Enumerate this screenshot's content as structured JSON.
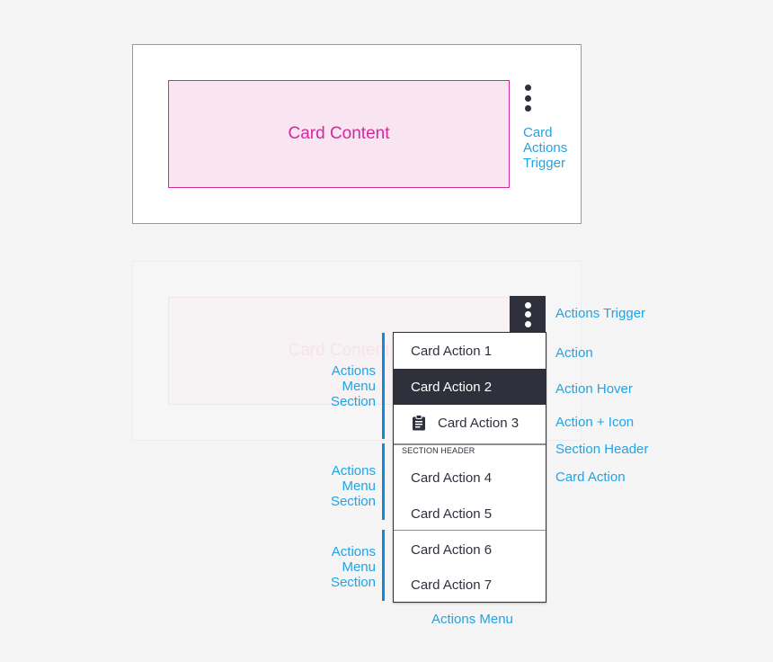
{
  "card_closed": {
    "content_label": "Card Content",
    "trigger_icon": "kebab-vertical-icon",
    "trigger_annotation": [
      "Card",
      "Actions",
      "Trigger"
    ]
  },
  "card_open": {
    "content_label": "Card Content",
    "trigger_icon": "kebab-vertical-icon"
  },
  "menu": {
    "sections": [
      {
        "header": null,
        "items": [
          {
            "label": "Card Action 1",
            "state": "default",
            "icon": null
          },
          {
            "label": "Card Action 2",
            "state": "hover",
            "icon": null
          },
          {
            "label": "Card Action 3",
            "state": "default",
            "icon": "clipboard-icon"
          }
        ]
      },
      {
        "header": "SECTION HEADER",
        "items": [
          {
            "label": "Card Action 4",
            "state": "default",
            "icon": null
          },
          {
            "label": "Card Action 5",
            "state": "default",
            "icon": null
          }
        ]
      },
      {
        "header": null,
        "items": [
          {
            "label": "Card Action 6",
            "state": "default",
            "icon": null
          },
          {
            "label": "Card Action 7",
            "state": "default",
            "icon": null
          }
        ]
      }
    ]
  },
  "annotations": {
    "section_label": [
      "Actions",
      "Menu",
      "Section"
    ],
    "right": {
      "actions_trigger": "Actions Trigger",
      "action": "Action",
      "action_hover": "Action Hover",
      "action_icon": "Action + Icon",
      "section_header": "Section Header",
      "card_action": "Card Action"
    },
    "menu": "Actions Menu"
  },
  "colors": {
    "background": "#f5f5f5",
    "annotation": "#1ea4e8",
    "section_bar": "#118bd9",
    "content_accent": "#d22a9e",
    "content_fill": "#f9e5f2",
    "dark": "#2e313b"
  }
}
